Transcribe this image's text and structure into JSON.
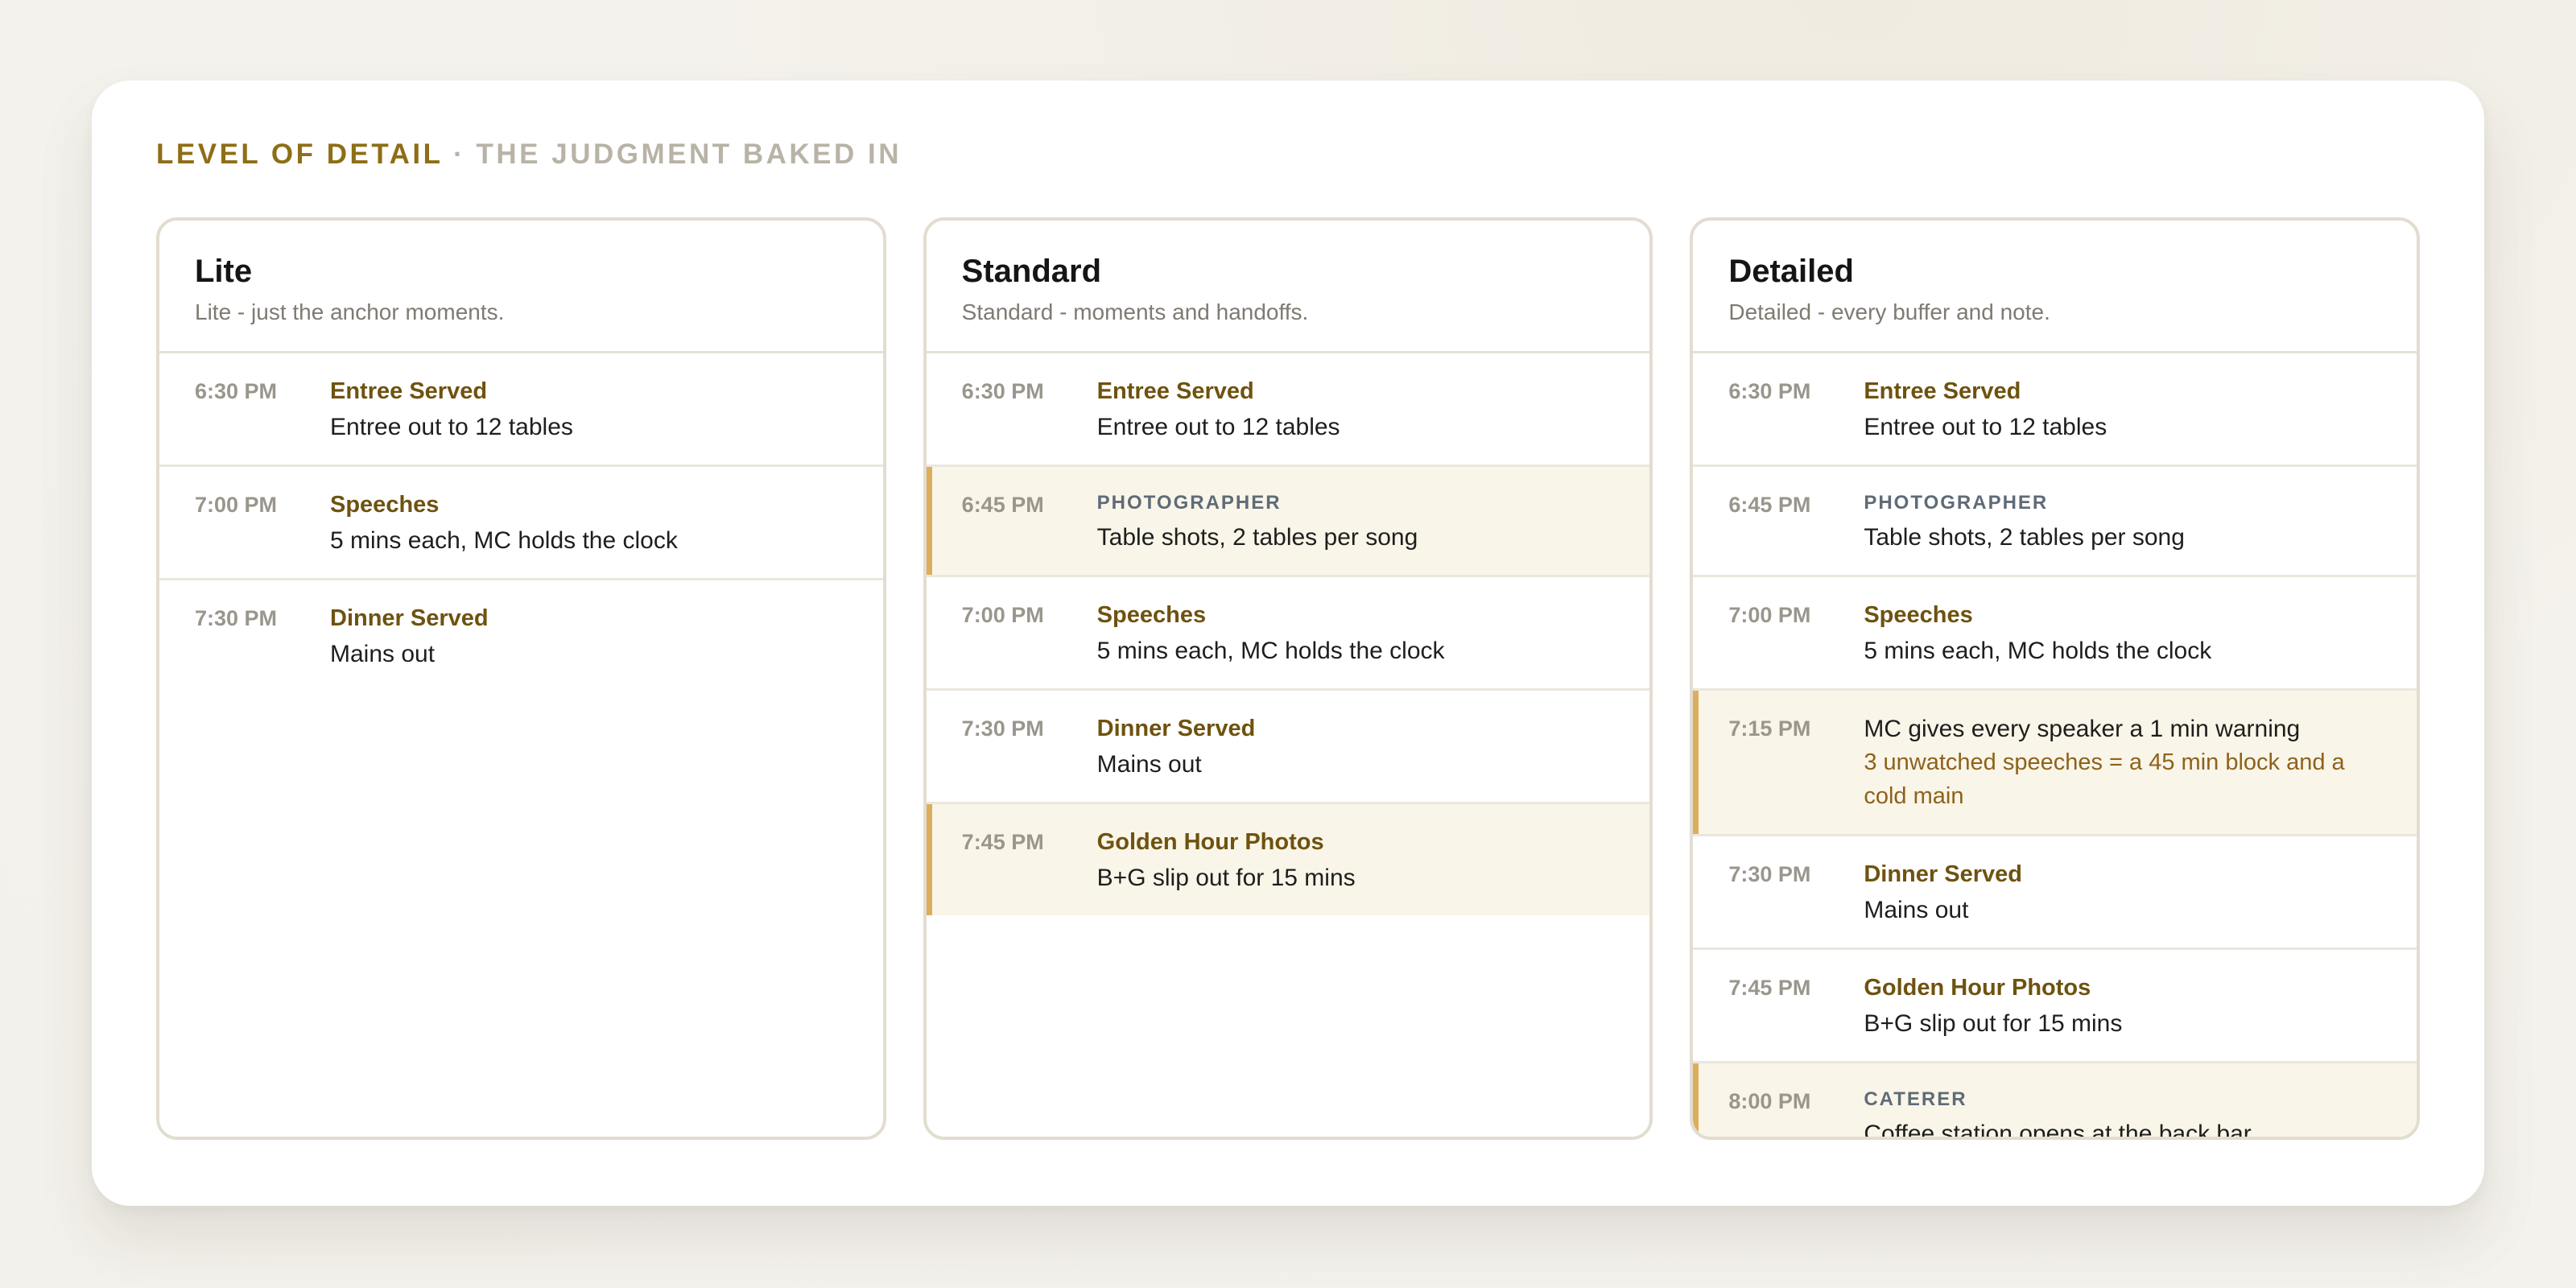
{
  "heading": {
    "main": "LEVEL OF DETAIL",
    "separator": "·",
    "sub": "THE JUDGMENT BAKED IN"
  },
  "colors": {
    "accent": "#8e6e16",
    "highlight_bg": "#f9f5e8",
    "highlight_bar": "#dcae5c",
    "warning": "#8e621c",
    "role": "#5f6b77"
  },
  "panels": [
    {
      "title": "Lite",
      "subtitle": "Lite - just the anchor moments.",
      "rows": [
        {
          "time": "6:30 PM",
          "label": "Entree Served",
          "desc": "Entree out to 12 tables"
        },
        {
          "time": "7:00 PM",
          "label": "Speeches",
          "desc": "5 mins each, MC holds the clock"
        },
        {
          "time": "7:30 PM",
          "label": "Dinner Served",
          "desc": "Mains out"
        }
      ]
    },
    {
      "title": "Standard",
      "subtitle": "Standard - moments and handoffs.",
      "rows": [
        {
          "time": "6:30 PM",
          "label": "Entree Served",
          "desc": "Entree out to 12 tables"
        },
        {
          "time": "6:45 PM",
          "label": "PHOTOGRAPHER",
          "desc": "Table shots, 2 tables per song"
        },
        {
          "time": "7:00 PM",
          "label": "Speeches",
          "desc": "5 mins each, MC holds the clock"
        },
        {
          "time": "7:30 PM",
          "label": "Dinner Served",
          "desc": "Mains out"
        },
        {
          "time": "7:45 PM",
          "label": "Golden Hour Photos",
          "desc": "B+G slip out for 15 mins"
        }
      ]
    },
    {
      "title": "Detailed",
      "subtitle": "Detailed - every buffer and note.",
      "rows": [
        {
          "time": "6:30 PM",
          "label": "Entree Served",
          "desc": "Entree out to 12 tables"
        },
        {
          "time": "6:45 PM",
          "label": "PHOTOGRAPHER",
          "desc": "Table shots, 2 tables per song"
        },
        {
          "time": "7:00 PM",
          "label": "Speeches",
          "desc": "5 mins each, MC holds the clock"
        },
        {
          "time": "7:15 PM",
          "desc": "MC gives every speaker a 1 min warning",
          "warning": "3 unwatched speeches = a 45 min block and a cold main"
        },
        {
          "time": "7:30 PM",
          "label": "Dinner Served",
          "desc": "Mains out"
        },
        {
          "time": "7:45 PM",
          "label": "Golden Hour Photos",
          "desc": "B+G slip out for 15 mins"
        },
        {
          "time": "8:00 PM",
          "label": "CATERER",
          "desc": "Coffee station opens at the back bar"
        }
      ]
    }
  ]
}
